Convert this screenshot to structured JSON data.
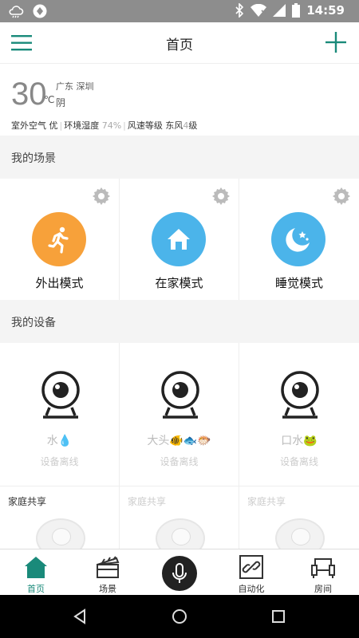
{
  "status_bar": {
    "time": "14:59",
    "left_icons": [
      "cloud-icon",
      "app-icon"
    ],
    "right_icons": [
      "bluetooth-icon",
      "wifi-icon",
      "signal-icon",
      "battery-icon"
    ]
  },
  "header": {
    "title": "首页",
    "menu_icon": "hamburger-menu-icon",
    "add_icon": "plus-icon",
    "accent_color": "#1a8a7a"
  },
  "weather": {
    "temperature": "30",
    "unit": "℃",
    "condition": "阴",
    "location": "广东 深圳",
    "outdoor_air_label": "室外空气",
    "outdoor_air_value": "优",
    "humidity_label": "环境湿度",
    "humidity_value": "74%",
    "wind_label": "风速等级",
    "wind_dir": "东风",
    "wind_level": "4",
    "wind_unit": "级"
  },
  "scenes": {
    "section_title": "我的场景",
    "items": [
      {
        "label": "外出模式",
        "icon": "running-person-icon",
        "color": "#f7a13a"
      },
      {
        "label": "在家模式",
        "icon": "home-icon",
        "color": "#4bb4ea"
      },
      {
        "label": "睡觉模式",
        "icon": "moon-stars-icon",
        "color": "#4bb4ea"
      }
    ]
  },
  "devices": {
    "section_title": "我的设备",
    "items": [
      {
        "name": "水💧",
        "status": "设备离线",
        "icon": "camera-icon"
      },
      {
        "name": "大头🐠🐟🐡",
        "status": "设备离线",
        "icon": "camera-icon"
      },
      {
        "name": "口水🐸",
        "status": "设备离线",
        "icon": "camera-icon"
      }
    ],
    "shared": [
      {
        "label": "家庭共享"
      },
      {
        "label": "家庭共享"
      },
      {
        "label": "家庭共享"
      }
    ]
  },
  "tab_bar": {
    "items": [
      {
        "label": "首页",
        "icon": "home-tab-icon",
        "active": true
      },
      {
        "label": "场景",
        "icon": "clapperboard-icon",
        "active": false
      },
      {
        "label": "",
        "icon": "microphone-icon",
        "active": false
      },
      {
        "label": "自动化",
        "icon": "link-icon",
        "active": false
      },
      {
        "label": "房间",
        "icon": "sofa-icon",
        "active": false
      }
    ]
  },
  "nav_bar": {
    "buttons": [
      "back-icon",
      "home-circle-icon",
      "recents-icon"
    ]
  }
}
